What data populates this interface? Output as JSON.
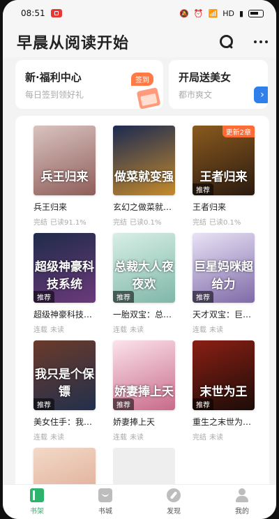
{
  "status_bar": {
    "time": "08:51",
    "network": "HD",
    "battery_level": 0.5
  },
  "header": {
    "title": "早晨从阅读开始",
    "search_icon": "search-icon",
    "more_icon": "more-icon"
  },
  "banners": [
    {
      "title": "新·福利中心",
      "subtitle": "每日签到领好礼",
      "tag": "签到"
    },
    {
      "title": "开局送美女",
      "subtitle": "都市爽文"
    }
  ],
  "books": [
    {
      "title": "兵王归来",
      "cover_text": "兵王归来",
      "status": "完结",
      "progress": "已读91.1%",
      "colors": [
        "#d9c3c0",
        "#8f5e5a"
      ],
      "badge": ""
    },
    {
      "title": "玄幻之做菜就…",
      "cover_text": "做菜就变强",
      "status": "完结",
      "progress": "已读0.1%",
      "colors": [
        "#1b2a52",
        "#c58a2b"
      ],
      "badge": ""
    },
    {
      "title": "王者归来",
      "cover_text": "王者归来",
      "status": "完结",
      "progress": "已读0.1%",
      "colors": [
        "#8a5a1e",
        "#2a1a10"
      ],
      "badge": "推荐",
      "update": "更新2章"
    },
    {
      "title": "超级神豪科技…",
      "cover_text": "超级神豪科技系统",
      "status": "连载",
      "progress": "未读",
      "colors": [
        "#1f2b4a",
        "#6b3a7a"
      ],
      "badge": "推荐"
    },
    {
      "title": "一胎双宝：总…",
      "cover_text": "总裁大人夜夜欢",
      "status": "连载",
      "progress": "未读",
      "colors": [
        "#d8efe6",
        "#7fb7a8"
      ],
      "badge": "推荐"
    },
    {
      "title": "天才双宝：巨…",
      "cover_text": "巨星妈咪超给力",
      "status": "连载",
      "progress": "未读",
      "colors": [
        "#e9e3f6",
        "#7f6aa8"
      ],
      "badge": "推荐"
    },
    {
      "title": "美女住手：我…",
      "cover_text": "我只是个保镖",
      "status": "连载",
      "progress": "未读",
      "colors": [
        "#6b3a2a",
        "#22304d"
      ],
      "badge": "推荐"
    },
    {
      "title": "娇妻捧上天",
      "cover_text": "娇妻捧上天",
      "status": "连载",
      "progress": "未读",
      "colors": [
        "#fbe3ea",
        "#c86a8a"
      ],
      "badge": "推荐"
    },
    {
      "title": "重生之末世为…",
      "cover_text": "末世为王",
      "status": "完结",
      "progress": "未读",
      "colors": [
        "#8a1f14",
        "#1b0c08"
      ],
      "badge": "推荐"
    },
    {
      "title": "",
      "cover_text": "",
      "status": "",
      "progress": "",
      "colors": [
        "#f3d9c8",
        "#d9a28a"
      ],
      "badge": ""
    },
    {
      "title": "",
      "cover_text": "",
      "status": "",
      "progress": "",
      "colors": [
        "#eeeeee",
        "#eeeeee"
      ],
      "badge": "",
      "empty": true
    }
  ],
  "tabs": [
    {
      "label": "书架",
      "icon": "shelf-icon",
      "active": true
    },
    {
      "label": "书城",
      "icon": "store-icon",
      "active": false
    },
    {
      "label": "发现",
      "icon": "discover-icon",
      "active": false
    },
    {
      "label": "我的",
      "icon": "me-icon",
      "active": false
    }
  ]
}
